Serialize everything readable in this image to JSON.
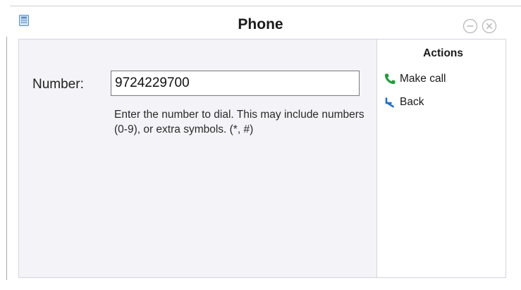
{
  "window": {
    "title": "Phone"
  },
  "form": {
    "number_label": "Number:",
    "number_value": "9724229700",
    "help_text": "Enter the number to dial. This may include numbers (0-9), or extra symbols. (*, #)"
  },
  "actions": {
    "title": "Actions",
    "items": [
      {
        "label": "Make call",
        "icon": "phone-icon",
        "color": "#1e9e3a"
      },
      {
        "label": "Back",
        "icon": "back-arrow-icon",
        "color": "#1f6fd0"
      }
    ]
  },
  "icons": {
    "app": "phone-app-icon",
    "minimize": "minimize-icon",
    "close": "close-icon"
  }
}
